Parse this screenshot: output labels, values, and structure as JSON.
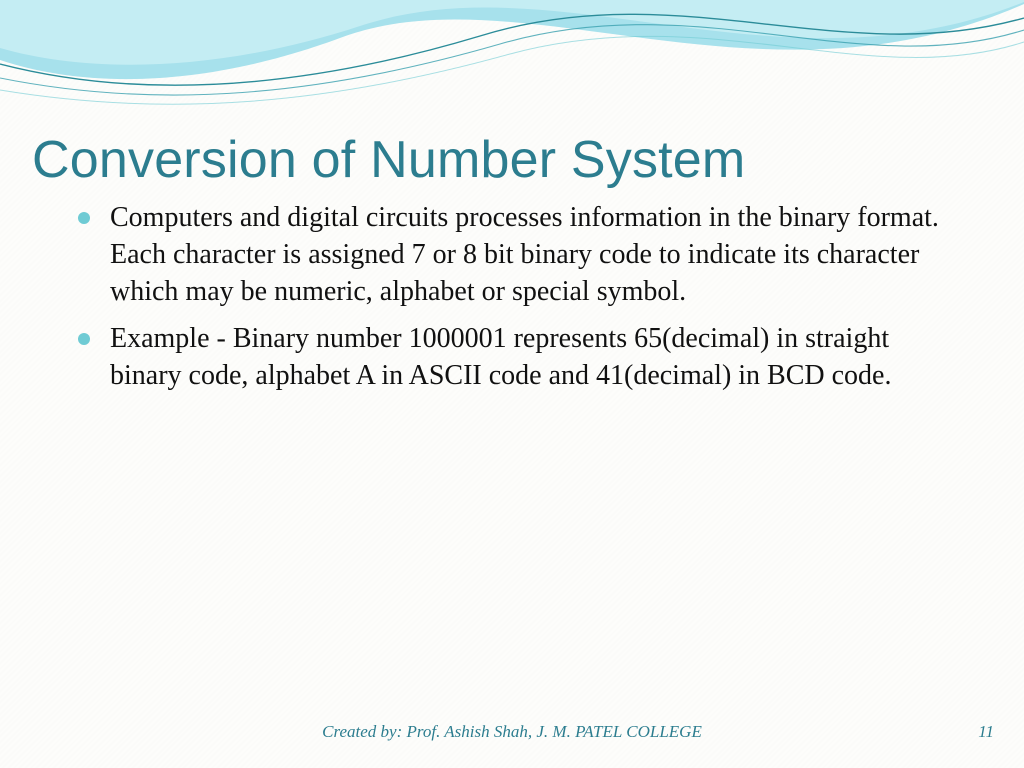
{
  "title": "Conversion of Number System",
  "bullets": [
    "Computers and digital circuits processes information in the binary format. Each character is assigned 7 or 8 bit binary code to indicate its character which may be numeric, alphabet or special symbol.",
    "Example - Binary number 1000001 represents 65(decimal) in straight binary code, alphabet A in ASCII code and 41(decimal) in BCD code."
  ],
  "footer": {
    "credit": "Created by: Prof. Ashish Shah, J. M. PATEL COLLEGE",
    "page": "11"
  },
  "theme": {
    "accent": "#2c7d8f",
    "bullet": "#6fcbd4",
    "wave_fill": "#9fe0ec",
    "wave_stroke1": "#2b8c99",
    "wave_stroke2": "#3aa0af"
  }
}
